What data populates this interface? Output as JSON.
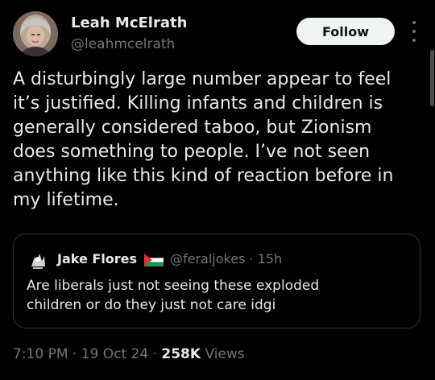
{
  "author": {
    "display_name": "Leah McElrath",
    "handle": "@leahmcelrath",
    "avatar_icon": "profile-photo"
  },
  "follow_button": {
    "label": "Follow"
  },
  "more_menu": {
    "icon": "vertical-ellipsis-icon"
  },
  "tweet": {
    "text": "A disturbingly large number appear to feel\nit’s justified. Killing infants and children is\ngenerally considered taboo, but Zionism\ndoes something to people. I’ve not seen\nanything like this kind of reaction before in\nmy lifetime."
  },
  "quoted_tweet": {
    "display_name": "Jake Flores",
    "flag_icon": "palestine-flag-icon",
    "handle_time": "@feraljokes · 15h",
    "text": "Are liberals just not seeing these exploded\nchildren or do they just not care idgi"
  },
  "meta": {
    "time_date": "7:10 PM · 19 Oct 24 · ",
    "views_count": "258K",
    "views_label": " Views"
  },
  "colors": {
    "background": "#000000",
    "text_primary": "#e7e9ea",
    "text_secondary": "#71767b",
    "border": "#2f3336",
    "follow_bg": "#eff3f4"
  }
}
